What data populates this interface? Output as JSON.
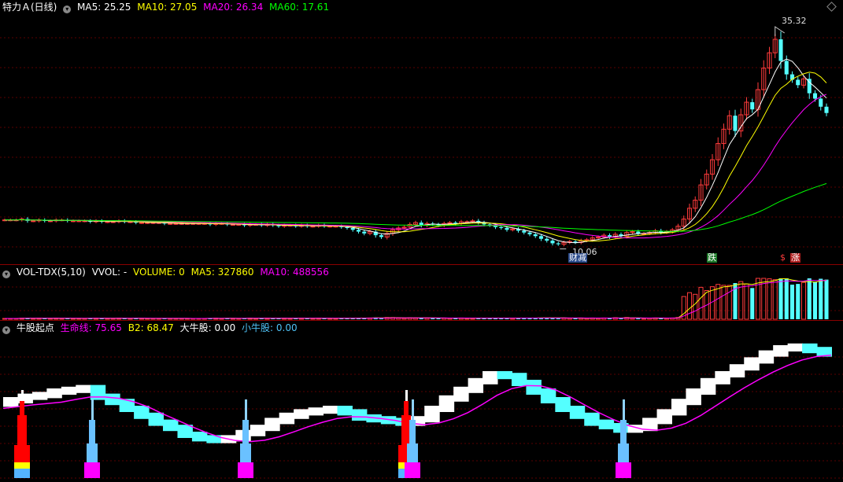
{
  "main_panel": {
    "title": "特力Ａ(日线)",
    "ma5": {
      "label": "MA5: 25.25",
      "color": "#ffffff"
    },
    "ma10": {
      "label": "MA10: 27.05",
      "color": "#ffff00"
    },
    "ma20": {
      "label": "MA20: 26.34",
      "color": "#ff00ff"
    },
    "ma60": {
      "label": "MA60: 17.61",
      "color": "#00ff00"
    },
    "high_label": "35.32",
    "low_label": "10.06",
    "events": [
      {
        "text": "财减",
        "color": "#ffffff",
        "bg": "#2a4a8a"
      },
      {
        "text": "跌",
        "color": "#ffffff",
        "bg": "#1e7a2a"
      },
      {
        "text": "$",
        "color": "#ff3b3b",
        "bg": "#000000"
      },
      {
        "text": "涨",
        "color": "#ffffff",
        "bg": "#b01e1e"
      }
    ]
  },
  "volume_panel": {
    "title": "VOL-TDX(5,10)",
    "vvol": "VVOL: -",
    "volume": "VOLUME: 0",
    "ma5": "MA5: 327860",
    "ma10": "MA10: 488556",
    "colors": {
      "volume": "#ffff00",
      "ma5": "#ffff00",
      "ma10": "#ff00ff"
    }
  },
  "indicator_panel": {
    "title": "牛股起点",
    "life_line": "生命线: 75.65",
    "b2": "B2: 68.47",
    "big_bull": "大牛股: 0.00",
    "small_bull": "小牛股: 0.00",
    "colors": {
      "life_line": "#ff00ff",
      "b2": "#ffff00",
      "big_bull": "#ffffff",
      "small_bull": "#4fc3f7"
    }
  },
  "chart_data": {
    "type": "candlestick",
    "price_ylim": [
      8.5,
      36.5
    ],
    "closes": [
      12.9,
      12.9,
      12.9,
      13.0,
      12.8,
      12.8,
      12.9,
      12.8,
      12.8,
      12.9,
      12.9,
      12.8,
      12.8,
      12.8,
      12.8,
      12.7,
      12.8,
      12.7,
      12.7,
      12.7,
      12.8,
      12.7,
      12.7,
      12.6,
      12.6,
      12.6,
      12.6,
      12.6,
      12.5,
      12.5,
      12.5,
      12.5,
      12.5,
      12.5,
      12.5,
      12.5,
      12.4,
      12.5,
      12.5,
      12.4,
      12.4,
      12.4,
      12.3,
      12.4,
      12.4,
      12.3,
      12.4,
      12.3,
      12.2,
      12.3,
      12.3,
      12.2,
      12.3,
      12.2,
      12.2,
      12.3,
      12.2,
      12.2,
      12.2,
      12.1,
      12.0,
      11.8,
      11.6,
      11.4,
      11.6,
      11.2,
      11.0,
      11.4,
      11.8,
      12.0,
      12.1,
      12.4,
      12.6,
      12.3,
      12.5,
      12.4,
      12.3,
      12.5,
      12.6,
      12.5,
      12.7,
      12.7,
      12.8,
      12.6,
      12.4,
      12.3,
      12.1,
      12.0,
      11.8,
      11.9,
      11.7,
      11.5,
      11.3,
      11.1,
      10.8,
      10.6,
      10.3,
      10.2,
      10.4,
      10.5,
      10.4,
      10.6,
      10.7,
      10.9,
      11.0,
      11.2,
      11.0,
      11.3,
      11.1,
      11.5,
      11.6,
      11.4,
      11.4,
      11.5,
      11.7,
      11.5,
      11.6,
      11.8,
      12.2,
      13.0,
      14.2,
      15.1,
      16.8,
      18.0,
      19.6,
      21.4,
      23.0,
      24.5,
      22.8,
      24.6,
      26.0,
      25.2,
      27.4,
      29.8,
      31.5,
      33.0,
      30.6,
      29.1,
      28.5,
      27.9,
      28.6,
      27.0,
      26.4,
      25.5,
      24.8
    ],
    "indicator_life_line": [
      43,
      45,
      47,
      48,
      50,
      51,
      52,
      47,
      44,
      40,
      36,
      32,
      29,
      25,
      23,
      22,
      23,
      26,
      29,
      33,
      36,
      38,
      39,
      40,
      38,
      35,
      34,
      33,
      32,
      34,
      40,
      46,
      51,
      56,
      60,
      59,
      55,
      50,
      45,
      40,
      36,
      32,
      30,
      28,
      29,
      33,
      38,
      44,
      50,
      56,
      60,
      64,
      68,
      72,
      75,
      76,
      74,
      72
    ]
  }
}
